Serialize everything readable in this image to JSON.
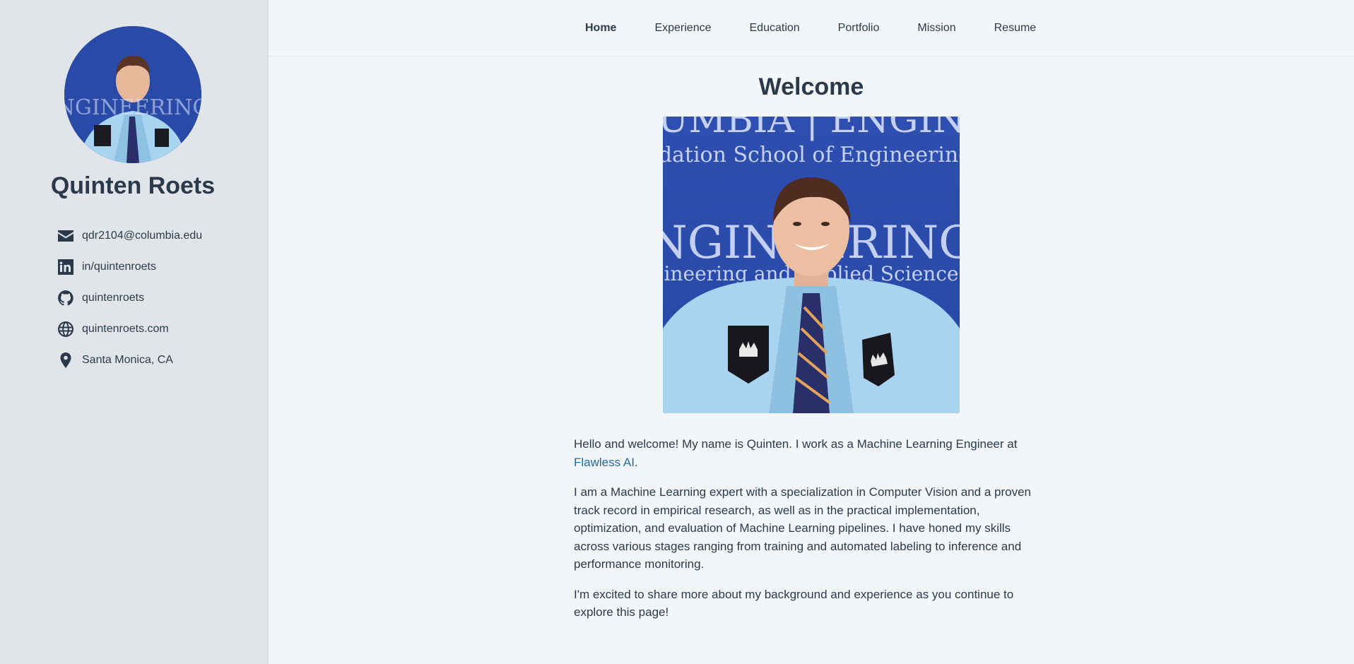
{
  "sidebar": {
    "name": "Quinten Roets",
    "contacts": [
      {
        "icon": "envelope-icon",
        "text": "qdr2104@columbia.edu"
      },
      {
        "icon": "linkedin-icon",
        "text": "in/quintenroets"
      },
      {
        "icon": "github-icon",
        "text": "quintenroets"
      },
      {
        "icon": "globe-icon",
        "text": "quintenroets.com"
      },
      {
        "icon": "location-pin-icon",
        "text": "Santa Monica, CA"
      }
    ]
  },
  "nav": {
    "items": [
      {
        "label": "Home",
        "active": true
      },
      {
        "label": "Experience"
      },
      {
        "label": "Education"
      },
      {
        "label": "Portfolio"
      },
      {
        "label": "Mission"
      },
      {
        "label": "Resume"
      }
    ]
  },
  "main": {
    "title": "Welcome",
    "intro_prefix": "Hello and welcome! My name is Quinten. I work as a Machine Learning Engineer at",
    "company_link": "Flawless AI",
    "intro_suffix": ".",
    "paragraph2": "I am a Machine Learning expert with a specialization in Computer Vision and a proven track record in empirical research, as well as in the practical implementation, optimization, and evaluation of Machine Learning pipelines. I have honed my skills across various stages ranging from training and automated labeling to inference and performance monitoring.",
    "paragraph3": "I'm excited to share more about my background and experience as you continue to explore this page!"
  },
  "colors": {
    "accent_link": "#1f6a9a",
    "text": "#2b3a4a",
    "sidebar_bg": "#e1e5ea",
    "page_bg": "#f3f6f9",
    "photo_bg": "#2a4aa8"
  }
}
